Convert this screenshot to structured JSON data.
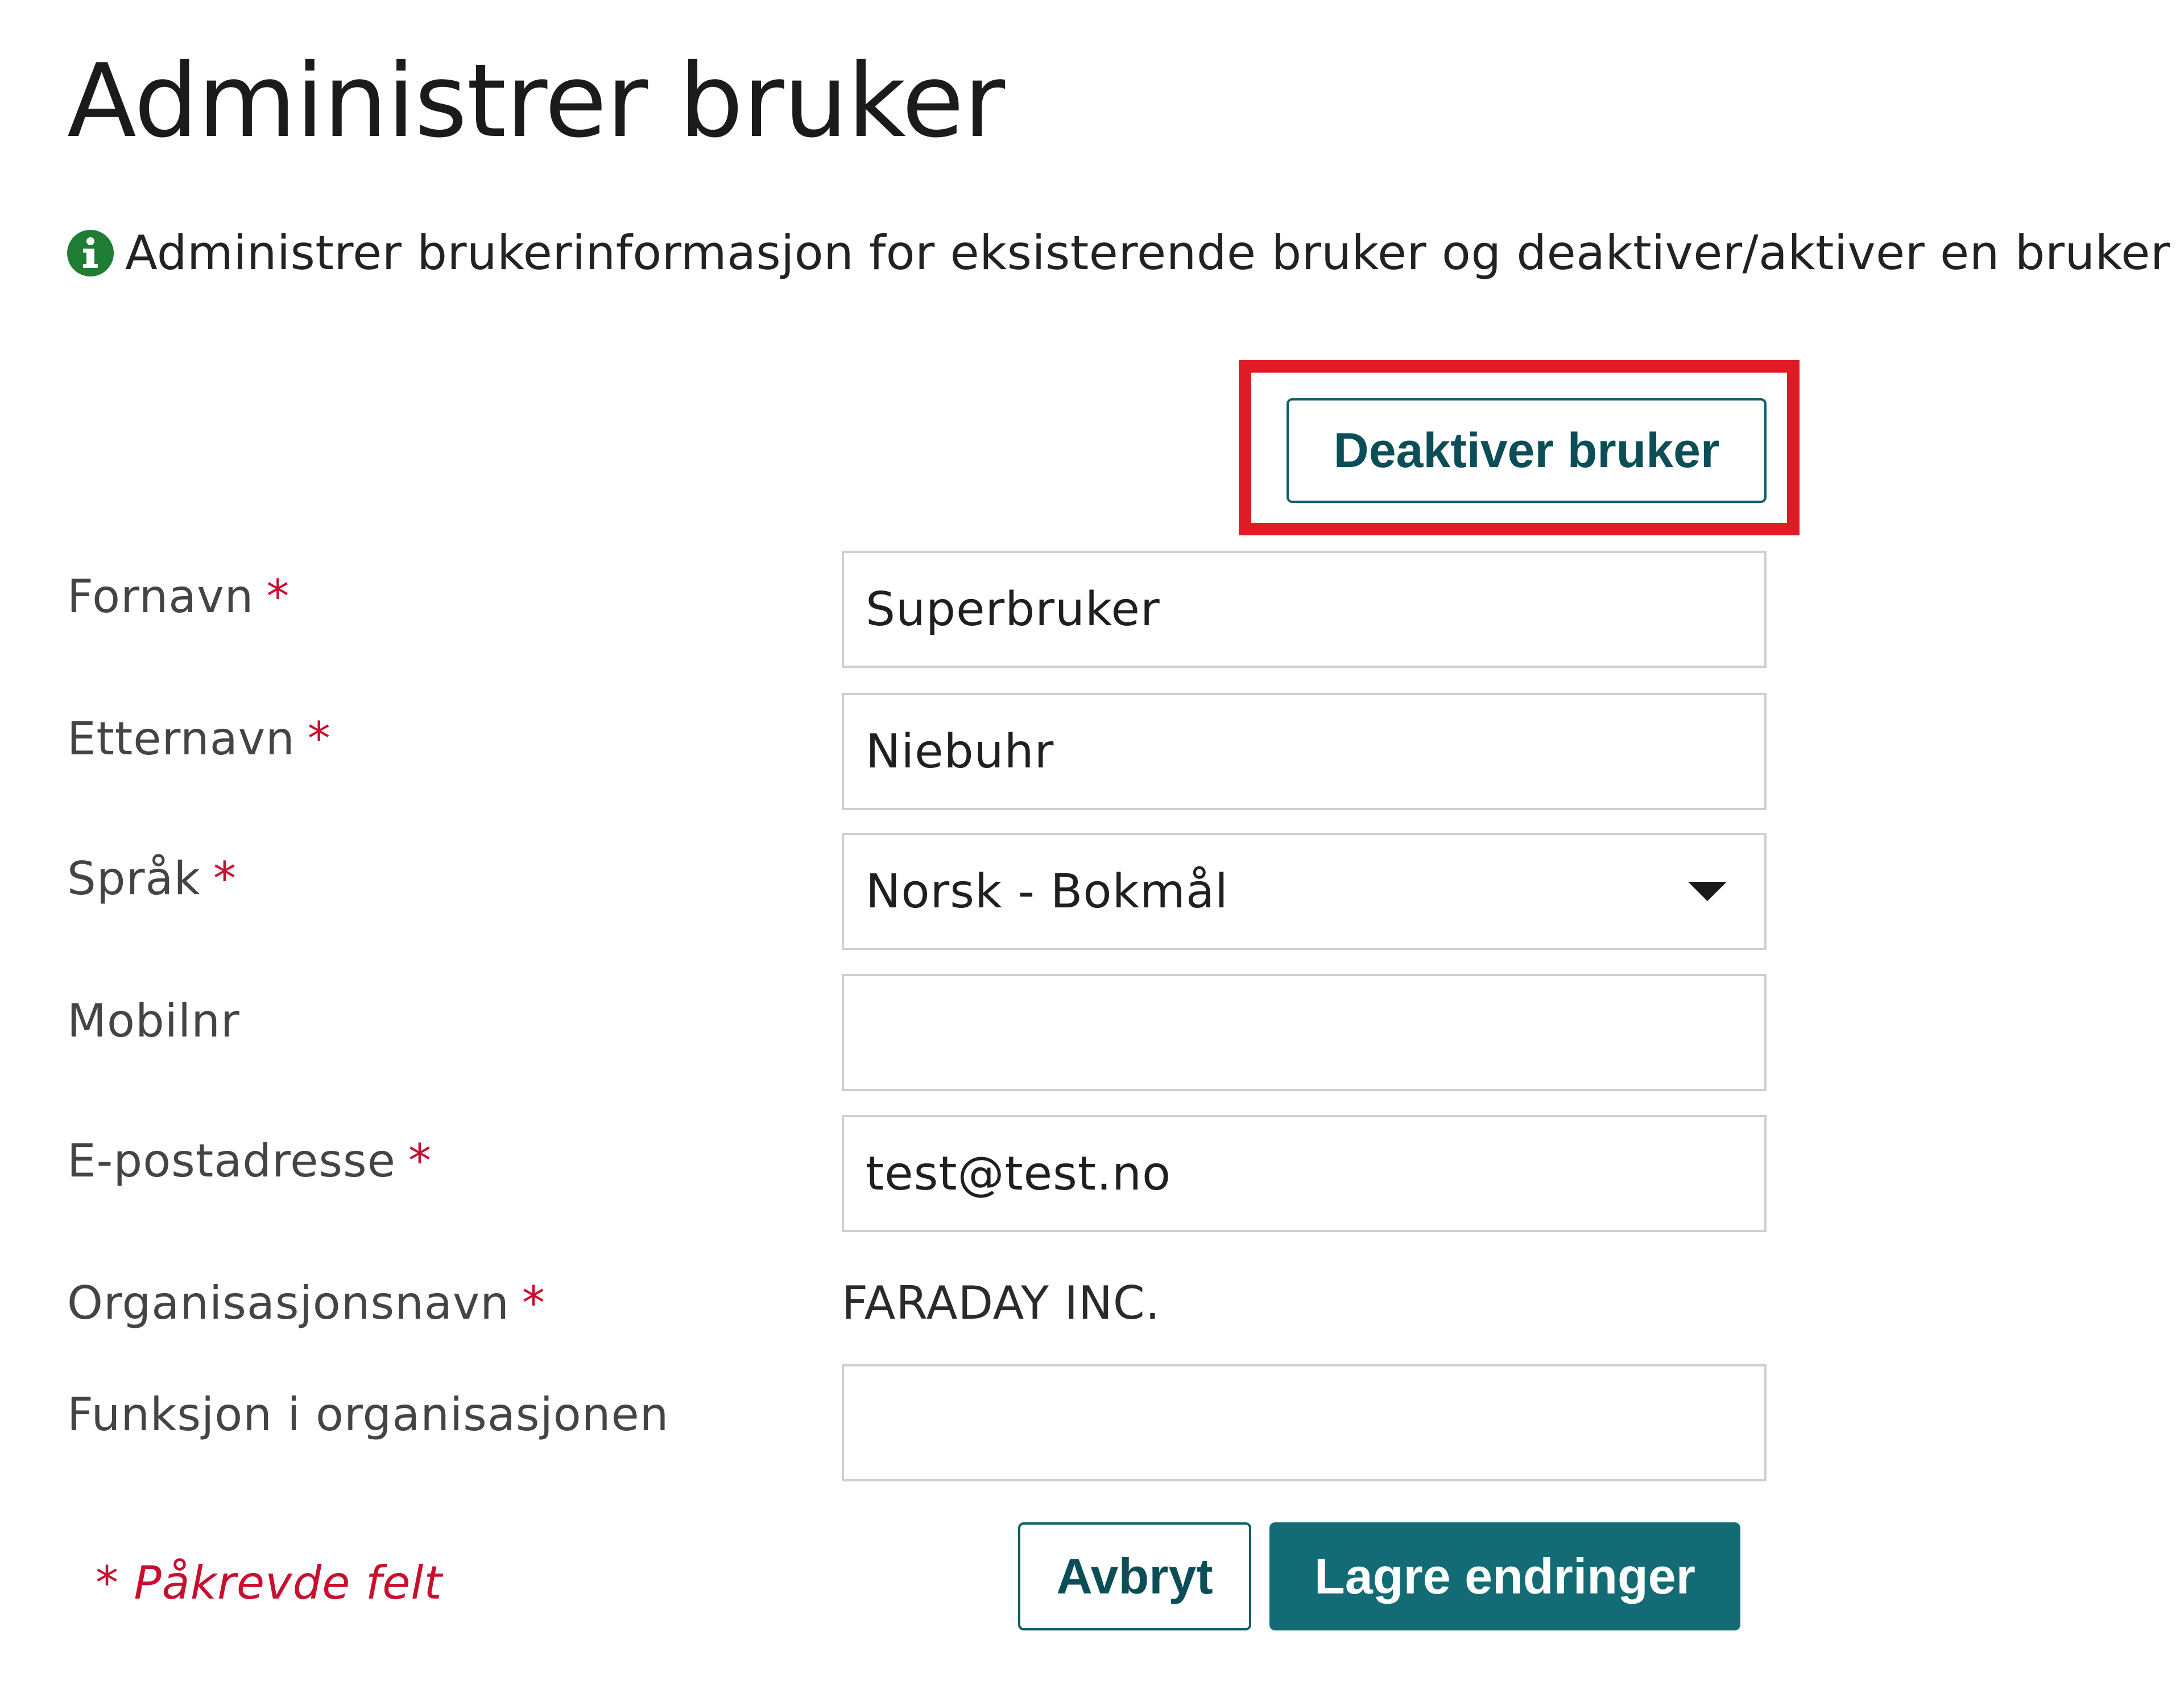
{
  "page": {
    "title": "Administrer bruker",
    "info_text": "Administrer brukerinformasjon for eksisterende bruker og deaktiver/aktiver en bruker",
    "info_icon": "info-icon"
  },
  "actions": {
    "deactivate_label": "Deaktiver bruker",
    "cancel_label": "Avbryt",
    "save_label": "Lagre endringer"
  },
  "form": {
    "required_marker": "*",
    "first_name": {
      "label": "Fornavn",
      "value": "Superbruker",
      "required": true
    },
    "last_name": {
      "label": "Etternavn",
      "value": "Niebuhr",
      "required": true
    },
    "language": {
      "label": "Språk",
      "value": "Norsk - Bokmål",
      "required": true
    },
    "mobile": {
      "label": "Mobilnr",
      "value": "",
      "required": false
    },
    "email": {
      "label": "E-postadresse",
      "value": "test@test.no",
      "required": true
    },
    "organization": {
      "label": "Organisasjonsnavn",
      "value": "FARADAY INC.",
      "required": true
    },
    "org_function": {
      "label": "Funksjon i organisasjonen",
      "value": "",
      "required": false
    },
    "required_note": "* Påkrevde felt"
  },
  "colors": {
    "accent": "#136c75",
    "highlight": "#e01b23",
    "required": "#c8102e",
    "info": "#1e7d32"
  }
}
